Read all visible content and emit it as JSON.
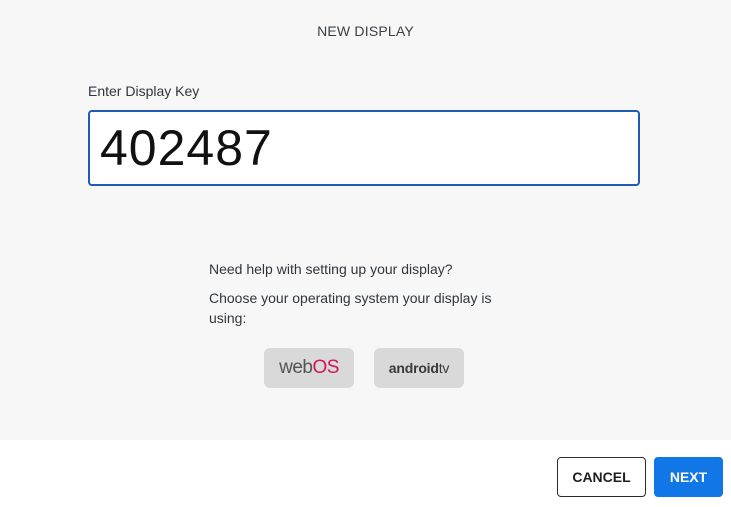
{
  "dialog": {
    "title": "NEW DISPLAY"
  },
  "display_key": {
    "label": "Enter Display Key",
    "value": "402487"
  },
  "help": {
    "question": "Need help with setting up your display?",
    "instruction": "Choose your operating system your display is using:"
  },
  "os_options": {
    "webos": {
      "part1": "web",
      "part2": "OS",
      "accent_color": "#d4145a"
    },
    "androidtv": {
      "part1": "android",
      "part2": "tv"
    }
  },
  "footer": {
    "cancel_label": "CANCEL",
    "next_label": "NEXT",
    "primary_color": "#1177e6"
  }
}
